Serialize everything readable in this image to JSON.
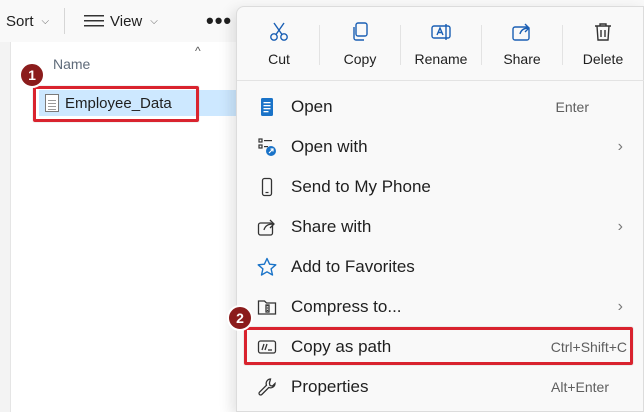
{
  "toolbar": {
    "sort_label": "Sort",
    "view_label": "View",
    "more_label": "•••"
  },
  "filelist": {
    "column_name": "Name",
    "file_name": "Employee_Data"
  },
  "badges": {
    "one": "1",
    "two": "2"
  },
  "quick_actions": [
    {
      "label": "Cut",
      "icon": "scissors-icon"
    },
    {
      "label": "Copy",
      "icon": "copy-icon"
    },
    {
      "label": "Rename",
      "icon": "rename-icon"
    },
    {
      "label": "Share",
      "icon": "share-icon"
    },
    {
      "label": "Delete",
      "icon": "trash-icon"
    }
  ],
  "menu_items": [
    {
      "label": "Open",
      "shortcut": "Enter",
      "icon": "document-icon"
    },
    {
      "label": "Open with",
      "submenu": true,
      "icon": "open-with-icon"
    },
    {
      "label": "Send to My Phone",
      "icon": "phone-icon"
    },
    {
      "label": "Share with",
      "submenu": true,
      "icon": "share-icon"
    },
    {
      "label": "Add to Favorites",
      "icon": "star-icon"
    },
    {
      "label": "Compress to...",
      "submenu": true,
      "icon": "folder-zip-icon"
    },
    {
      "label": "Copy as path",
      "shortcut": "Ctrl+Shift+C",
      "icon": "path-icon"
    },
    {
      "label": "Properties",
      "shortcut": "Alt+Enter",
      "icon": "wrench-icon"
    }
  ],
  "colors": {
    "highlight": "#d9232e",
    "badge": "#8b1c1c",
    "accent": "#0067c0",
    "selection": "#cde8ff"
  }
}
